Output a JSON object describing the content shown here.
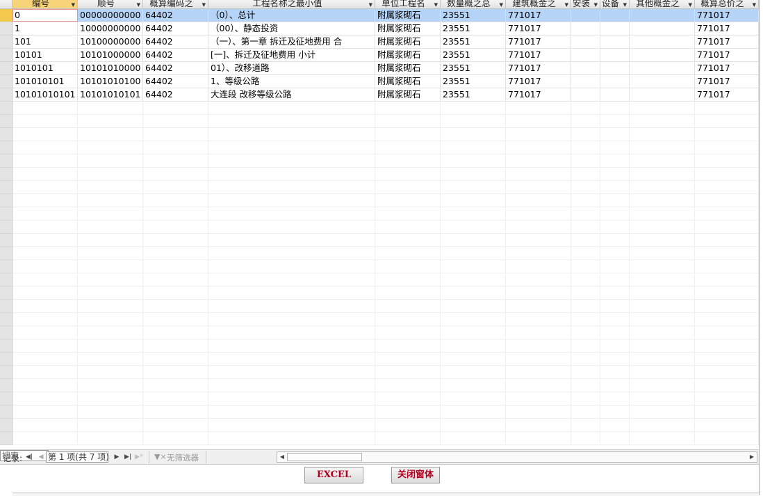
{
  "columns": [
    {
      "label": "编号"
    },
    {
      "label": "顺号"
    },
    {
      "label": "概算编码之"
    },
    {
      "label": "工程名称之最小值"
    },
    {
      "label": "单位工程名"
    },
    {
      "label": "数量概之总"
    },
    {
      "label": "建筑概金之"
    },
    {
      "label": "安装"
    },
    {
      "label": "设备"
    },
    {
      "label": "其他概金之"
    },
    {
      "label": "概算总价之"
    }
  ],
  "rows": [
    [
      "0",
      "00000000000",
      "64402",
      "（0）、总计",
      "附属浆砌石",
      "23551",
      "771017",
      "",
      "",
      "",
      "771017"
    ],
    [
      "1",
      "10000000000",
      "64402",
      "（00）、静态投资",
      "附属浆砌石",
      "23551",
      "771017",
      "",
      "",
      "",
      "771017"
    ],
    [
      "101",
      "10100000000",
      "64402",
      "（一）、第一章 拆迁及征地费用 合",
      "附属浆砌石",
      "23551",
      "771017",
      "",
      "",
      "",
      "771017"
    ],
    [
      "10101",
      "10101000000",
      "64402",
      "[一]、拆迁及征地费用 小计",
      "附属浆砌石",
      "23551",
      "771017",
      "",
      "",
      "",
      "771017"
    ],
    [
      "1010101",
      "10101010000",
      "64402",
      "01）、改移道路",
      "附属浆砌石",
      "23551",
      "771017",
      "",
      "",
      "",
      "771017"
    ],
    [
      "101010101",
      "10101010100",
      "64402",
      "1、等级公路",
      "附属浆砌石",
      "23551",
      "771017",
      "",
      "",
      "",
      "771017"
    ],
    [
      "10101010101",
      "10101010101",
      "64402",
      "大连段 改移等级公路",
      "附属浆砌石",
      "23551",
      "771017",
      "",
      "",
      "",
      "771017"
    ]
  ],
  "nav": {
    "record_label": "记录:",
    "position": "第 1 项(共 7 项)",
    "filter_label": "无筛选器",
    "search_placeholder": "搜索"
  },
  "buttons": {
    "excel": "EXCEL",
    "close": "关闭窗体"
  },
  "colors": {
    "active_row": "#b5d4f7",
    "current_selector": "#f2c94c",
    "button_text": "#b00020"
  }
}
